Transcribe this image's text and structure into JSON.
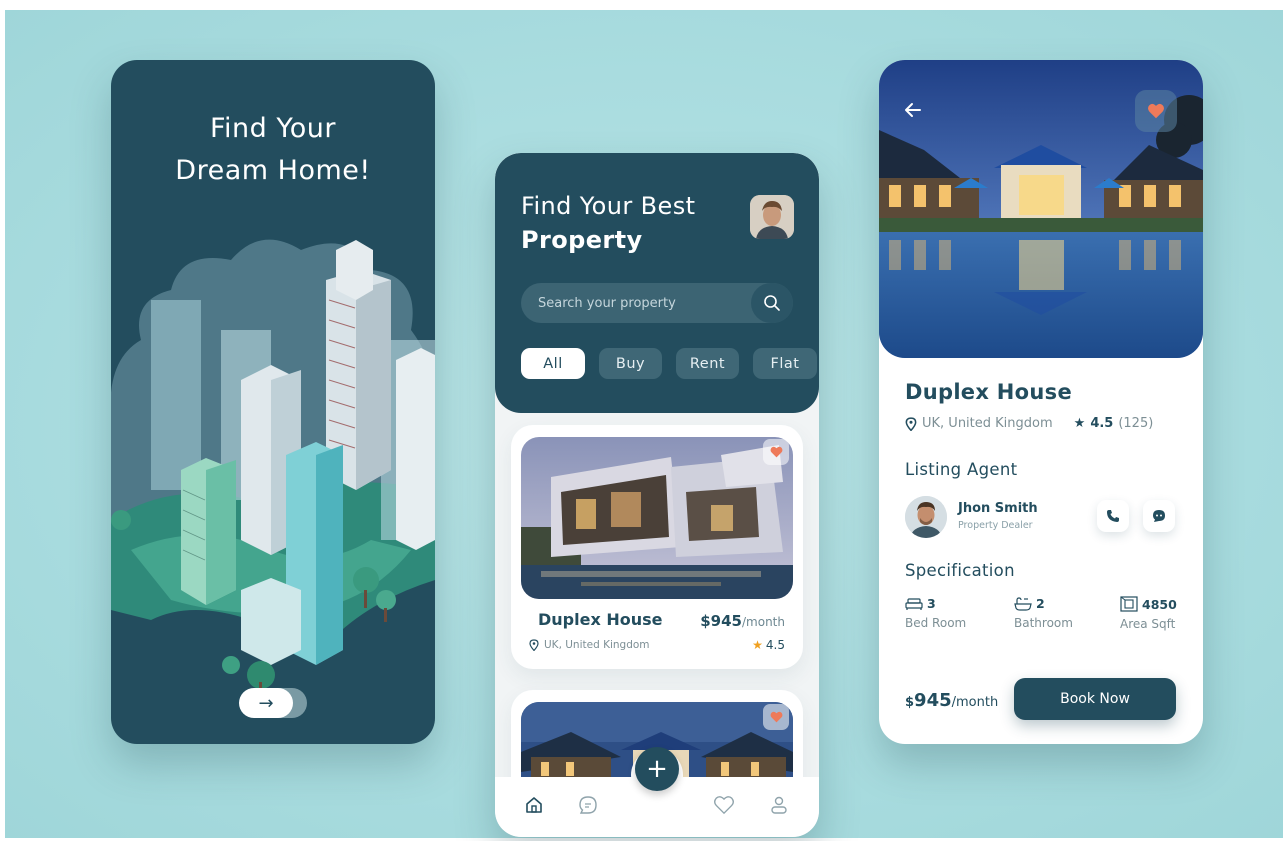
{
  "screen1": {
    "title_line1": "Find Your",
    "title_line2": "Dream Home!",
    "next_icon": "→"
  },
  "screen2": {
    "header_light": "Find Your Best",
    "header_bold": "Property",
    "search": {
      "placeholder": "Search your property"
    },
    "chips": [
      "All",
      "Buy",
      "Rent",
      "Flat"
    ],
    "active_chip": "All",
    "listings": [
      {
        "name": "Duplex House",
        "price": "$945",
        "period": "/month",
        "location": "UK, United Kingdom",
        "rating": "4.5"
      }
    ],
    "fab_icon": "+",
    "nav": [
      "home-icon",
      "chat-icon",
      "heart-icon",
      "profile-icon"
    ]
  },
  "screen3": {
    "title": "Duplex House",
    "location": "UK, United Kingdom",
    "rating": "4.5",
    "reviews": "(125)",
    "listing_agent_label": "Listing Agent",
    "agent": {
      "name": "Jhon Smith",
      "role": "Property Dealer"
    },
    "specification_label": "Specification",
    "specs": [
      {
        "value": "3",
        "label": "Bed Room",
        "icon": "bed-icon"
      },
      {
        "value": "2",
        "label": "Bathroom",
        "icon": "bathtub-icon"
      },
      {
        "value": "4850",
        "label": "Area Sqft",
        "icon": "area-icon"
      }
    ],
    "price_currency": "$",
    "price_value": "945",
    "price_period": "/month",
    "book_label": "Book Now"
  },
  "colors": {
    "primary": "#234d5e",
    "background": "#a9dcdf",
    "accent_heart": "#ee7a5a",
    "star": "#f0a020"
  }
}
